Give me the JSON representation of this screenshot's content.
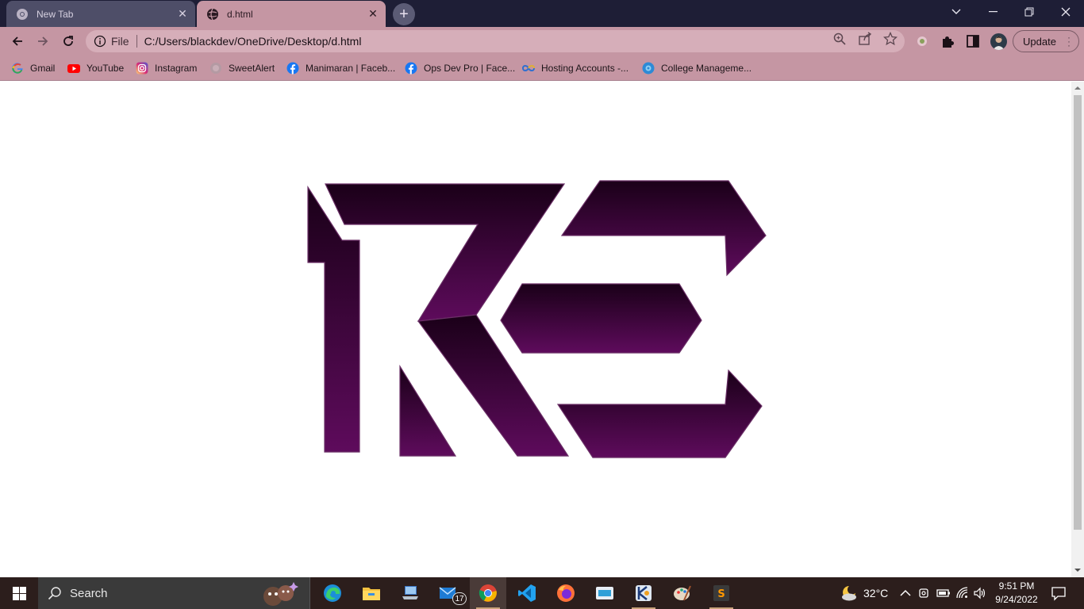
{
  "tabs": [
    {
      "title": "New Tab",
      "active": false,
      "icon": "chrome-icon"
    },
    {
      "title": "d.html",
      "active": true,
      "icon": "globe-icon"
    }
  ],
  "address_bar": {
    "scheme_label": "File",
    "url": "C:/Users/blackdev/OneDrive/Desktop/d.html"
  },
  "toolbar": {
    "update_label": "Update"
  },
  "bookmarks": [
    {
      "label": "Gmail",
      "icon": "google-icon"
    },
    {
      "label": "YouTube",
      "icon": "youtube-icon"
    },
    {
      "label": "Instagram",
      "icon": "instagram-icon"
    },
    {
      "label": "SweetAlert",
      "icon": "sweetalert-icon"
    },
    {
      "label": "Manimaran | Faceb...",
      "icon": "facebook-icon"
    },
    {
      "label": "Ops Dev Pro | Face...",
      "icon": "facebook-icon"
    },
    {
      "label": "Hosting Accounts -...",
      "icon": "infinity-icon"
    },
    {
      "label": "College Manageme...",
      "icon": "gear-globe-icon"
    }
  ],
  "page": {
    "logo": {
      "kind": "KE monogram",
      "gradient_top": "#1a0018",
      "gradient_bottom": "#5e0b5c"
    }
  },
  "taskbar": {
    "search_label": "Search",
    "mail_badge": "17",
    "apps": [
      "edge-icon",
      "file-explorer-icon",
      "laptop-icon",
      "mail-icon",
      "chrome-icon",
      "vscode-icon",
      "firefox-icon",
      "media-icon",
      "app-icon",
      "paint-icon",
      "sublime-icon"
    ],
    "weather": "32°C",
    "time": "9:51 PM",
    "date": "9/24/2022"
  },
  "colors": {
    "titlebar": "#1e1e36",
    "toolbar": "#c596a3",
    "taskbar": "#2c1e1c"
  }
}
